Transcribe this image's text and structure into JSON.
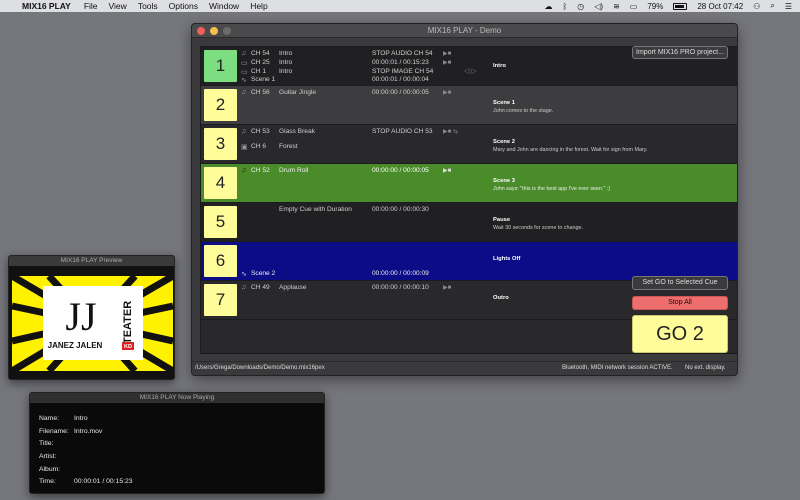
{
  "menubar": {
    "app_name": "MIX16 PLAY",
    "items": [
      "File",
      "View",
      "Tools",
      "Options",
      "Window",
      "Help"
    ],
    "battery": "79%",
    "datetime": "28 Oct  07:42"
  },
  "main_window": {
    "title": "MIX16 PLAY - Demo",
    "cues": [
      {
        "number": "1",
        "lines": [
          {
            "icon": "♫",
            "channel": "CH 54",
            "name": "Intro",
            "status": "STOP AUDIO CH 54"
          },
          {
            "icon": "▭",
            "channel": "CH 25",
            "name": "Intro",
            "status": "00:00:01 / 00:15:23"
          },
          {
            "icon": "▭",
            "channel": "CH 1",
            "name": "Intro",
            "status": "STOP IMAGE CH 54"
          },
          {
            "icon": "∿",
            "channel": "Scene 1",
            "name": "",
            "status": "00:00:01 / 00:00:04"
          }
        ],
        "scene_title": "Intro",
        "scene_desc": ""
      },
      {
        "number": "2",
        "lines": [
          {
            "icon": "♫",
            "channel": "CH 56",
            "name": "Guitar Jingle",
            "status": "00:00:00 / 00:00:05"
          }
        ],
        "scene_title": "Scene 1",
        "scene_desc": "John comes to the stage."
      },
      {
        "number": "3",
        "lines": [
          {
            "icon": "♫",
            "channel": "CH 53",
            "name": "Glass Break",
            "status": "STOP AUDIO CH 53"
          },
          {
            "icon": "▣",
            "channel": "CH 6",
            "name": "Forest",
            "status": ""
          }
        ],
        "scene_title": "Scene 2",
        "scene_desc": "Mary and John are dancing in the forest. Wait for sign from Mary."
      },
      {
        "number": "4",
        "lines": [
          {
            "icon": "♫",
            "channel": "CH 52",
            "name": "Drum Roll",
            "status": "00:00:00 / 00:00:05"
          }
        ],
        "scene_title": "Scene 3",
        "scene_desc": "John says: \"this is the best app I've ever seen.\" :)"
      },
      {
        "number": "5",
        "lines": [
          {
            "icon": "",
            "channel": "",
            "name": "Empty Cue with Duration",
            "status": "00:00:00 / 00:00:30"
          }
        ],
        "scene_title": "Pause",
        "scene_desc": "Wait 30 seconds for scene to change."
      },
      {
        "number": "6",
        "lines": [
          {
            "icon": "∿",
            "channel": "Scene 2",
            "name": "",
            "status": "00:00:00 / 00:00:09"
          }
        ],
        "scene_title": "Lights Off",
        "scene_desc": ""
      },
      {
        "number": "7",
        "lines": [
          {
            "icon": "♫",
            "channel": "CH 49",
            "name": "Applause",
            "status": "00:00:00 / 00:00:10"
          }
        ],
        "scene_title": "Outro",
        "scene_desc": ""
      }
    ],
    "buttons": {
      "import": "Import MIX16 PRO project...",
      "set_go": "Set GO to Selected Cue",
      "stop_all": "Stop All",
      "go": "GO 2"
    },
    "status": {
      "path": "/Users/Grega/Downloads/Demo/Demo.mix16pex",
      "session": "Bluetooth, MIDI network session ACTIVE.",
      "display": "No ext. display."
    }
  },
  "preview_window": {
    "title": "MIX16 PLAY Preview",
    "logo_text": {
      "brand": "JJ",
      "name": "JANEZ JALEN",
      "teater": "TEATER",
      "badge": "KD"
    }
  },
  "now_playing": {
    "title": "MIX16 PLAY Now Playing",
    "fields": [
      {
        "label": "Name:",
        "value": "Intro"
      },
      {
        "label": "Filename:",
        "value": "Intro.mov"
      },
      {
        "label": "Title:",
        "value": ""
      },
      {
        "label": "Artist:",
        "value": ""
      },
      {
        "label": "Album:",
        "value": ""
      },
      {
        "label": "Time:",
        "value": "00:00:01 / 00:15:23"
      }
    ]
  },
  "colors": {
    "cue_yellow": "#fffd9a",
    "cue_active_green": "#7cde80",
    "row_highlight_green": "#4a8c2a",
    "row_highlight_blue": "#0c0c86",
    "stop_button": "#ee6e6e"
  }
}
